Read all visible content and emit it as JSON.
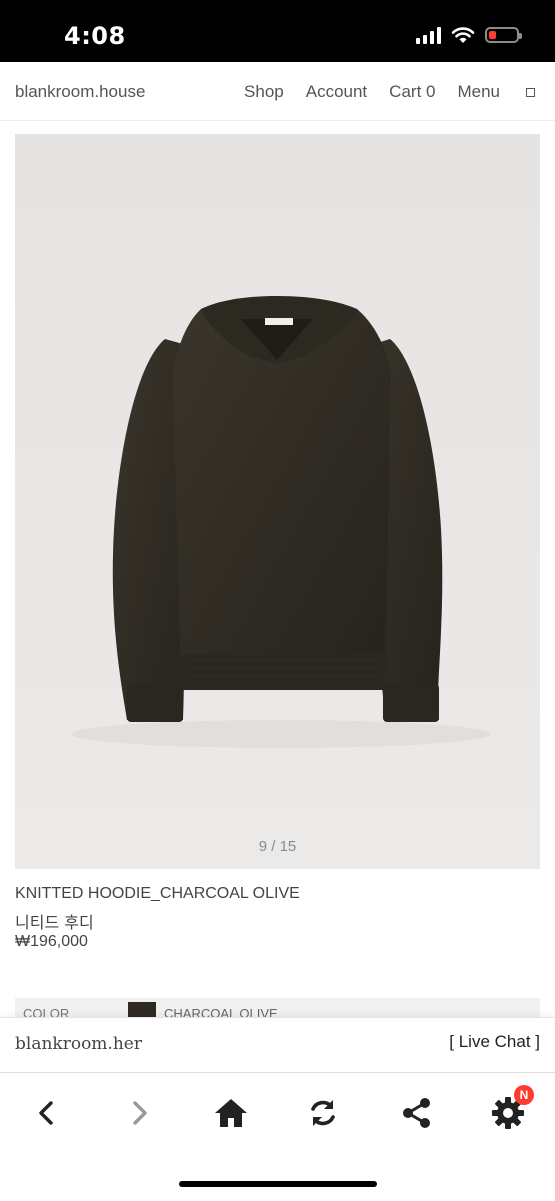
{
  "status_bar": {
    "time": "4:08"
  },
  "nav": {
    "brand": "blankroom.house",
    "links": [
      "Shop",
      "Account",
      "Cart 0",
      "Menu"
    ]
  },
  "product": {
    "pager": "9 / 15",
    "title": "KNITTED HOODIE_CHARCOAL OLIVE",
    "subtitle": "니티드 후디",
    "price": "₩196,000",
    "color_label": "COLOR",
    "color_value": "CHARCOAL OLIVE",
    "swatch_color": "#2e2a22"
  },
  "footer": {
    "brand": "blankroom.her",
    "live_chat": "[ Live Chat ]"
  },
  "toolbar": {
    "icons": [
      "back-icon",
      "forward-icon",
      "home-icon",
      "refresh-icon",
      "share-icon",
      "settings-icon"
    ],
    "badge": "N",
    "badge_color": "#ff3b30"
  }
}
